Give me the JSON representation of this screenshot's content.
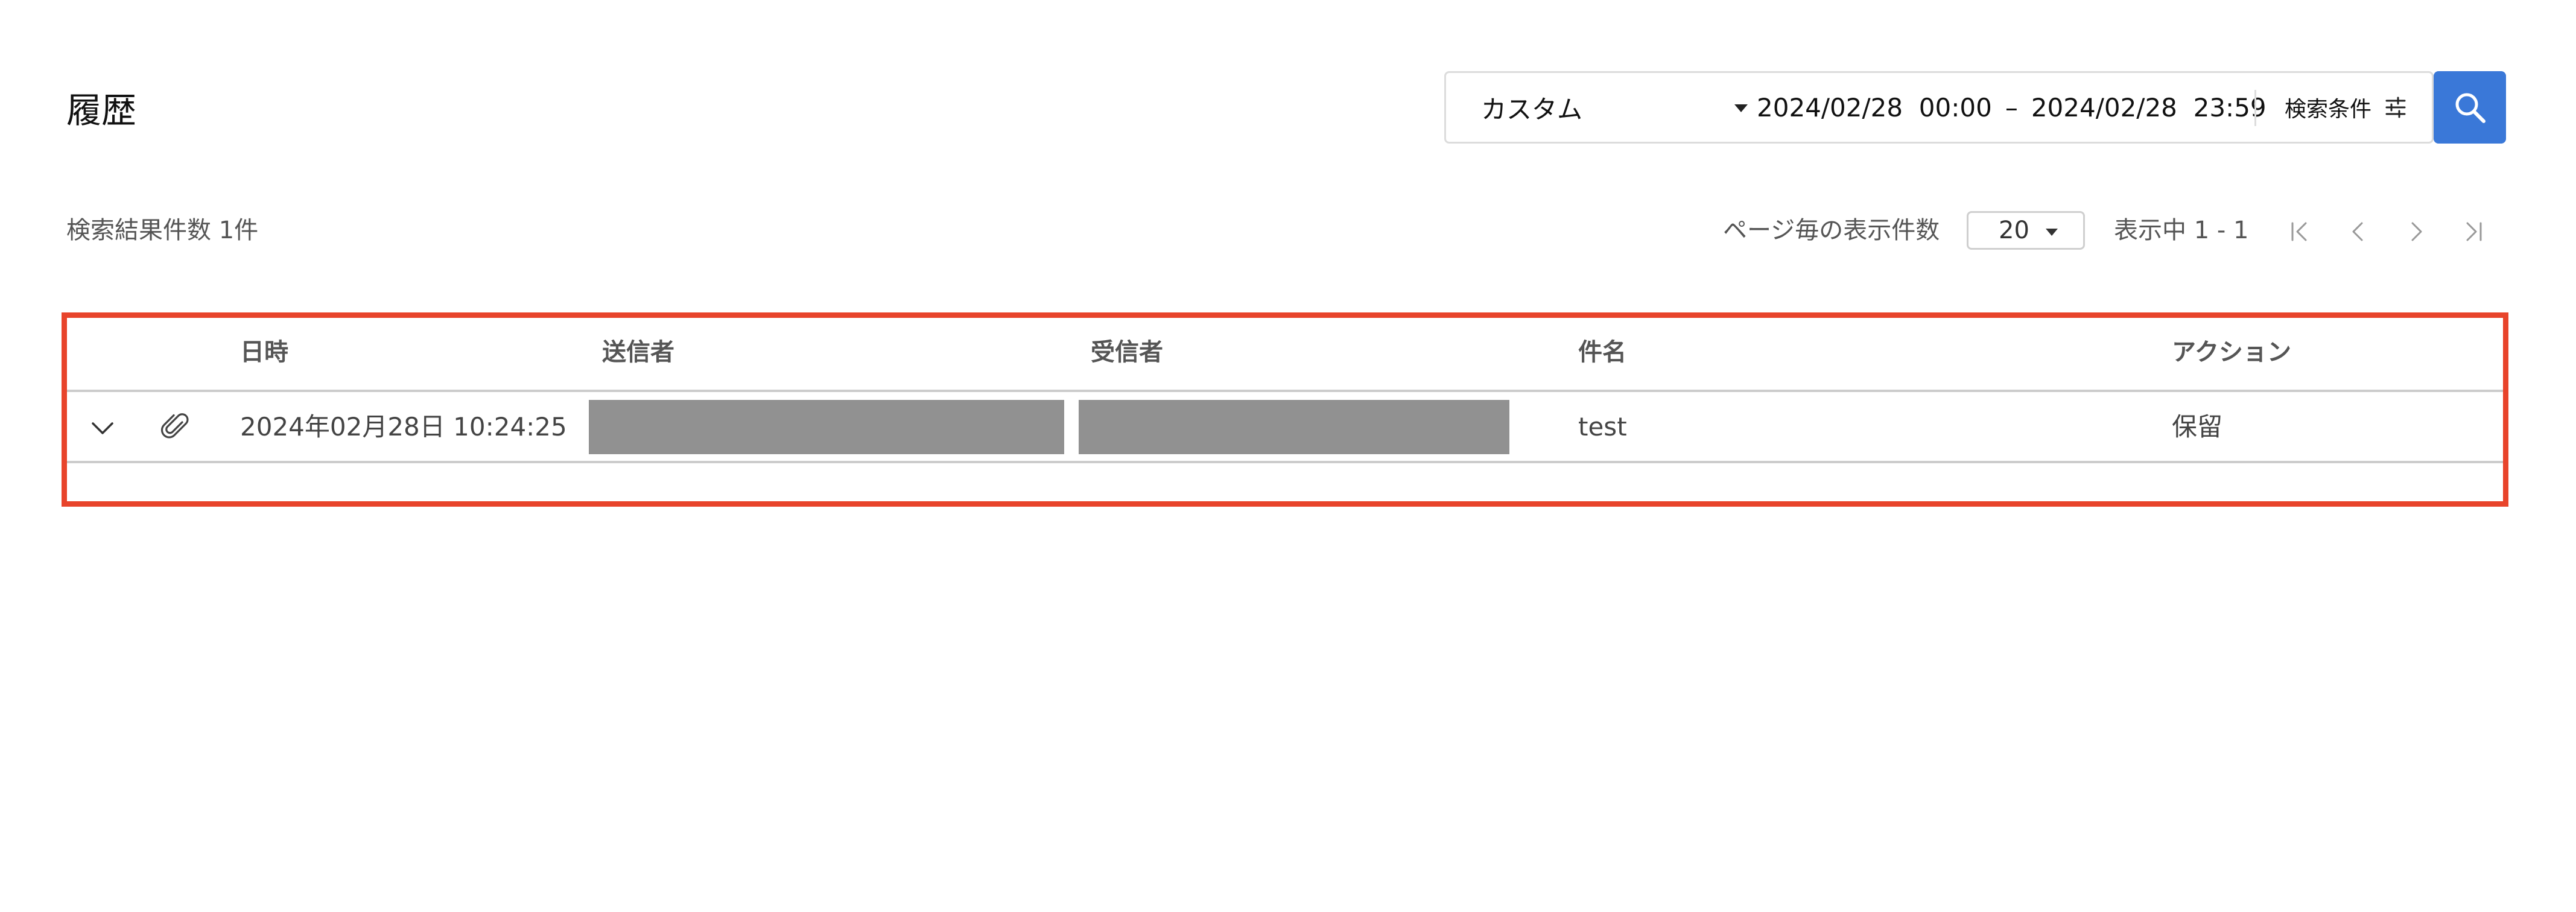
{
  "header": {
    "title": "履歴"
  },
  "search": {
    "range_type": "カスタム",
    "start_date": "2024/02/28",
    "start_time": "00:00",
    "separator": "–",
    "end_date": "2024/02/28",
    "end_time": "23:59",
    "conditions_label": "検索条件",
    "conditions_icon": "sliders-icon",
    "search_icon": "search-icon",
    "accent_color": "#3a78d8"
  },
  "results": {
    "count_label": "検索結果件数 1件",
    "per_page_label": "ページ毎の表示件数",
    "per_page_value": "20",
    "showing_label": "表示中 1 - 1",
    "pager_icons": [
      "first-page-icon",
      "prev-page-icon",
      "next-page-icon",
      "last-page-icon"
    ]
  },
  "table": {
    "highlight_color": "#e8442b",
    "columns": [
      "日時",
      "送信者",
      "受信者",
      "件名",
      "アクション"
    ],
    "rows": [
      {
        "datetime": "2024年02月28日 10:24:25",
        "sender": "",
        "recipient": "",
        "subject": "test",
        "action": "保留",
        "has_attachment": true
      }
    ]
  }
}
